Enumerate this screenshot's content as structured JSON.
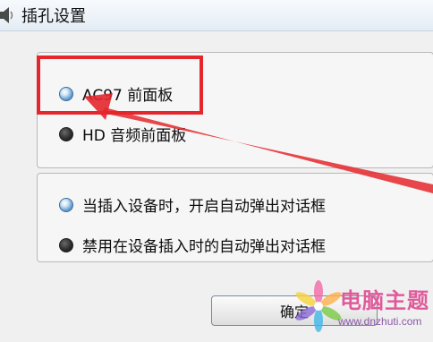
{
  "window": {
    "title": "插孔设置"
  },
  "connector_group": {
    "options": [
      {
        "label": "AC97 前面板",
        "selected": true
      },
      {
        "label": "HD 音频前面板",
        "selected": false
      }
    ]
  },
  "behavior_group": {
    "options": [
      {
        "label": "当插入设备时，开启自动弹出对话框",
        "selected": true
      },
      {
        "label": "禁用在设备插入时的自动弹出对话框",
        "selected": false
      }
    ]
  },
  "buttons": {
    "ok_label": "确定"
  },
  "watermark": {
    "title": "电脑主题",
    "url": "www.dnzhuti.com"
  },
  "colors": {
    "highlight": "#e4272c",
    "radio_selected": "#6ea4d3",
    "radio_unselected": "#2e2e2e"
  },
  "icons": {
    "title": "speaker-icon",
    "watermark": "flower-logo-icon"
  }
}
